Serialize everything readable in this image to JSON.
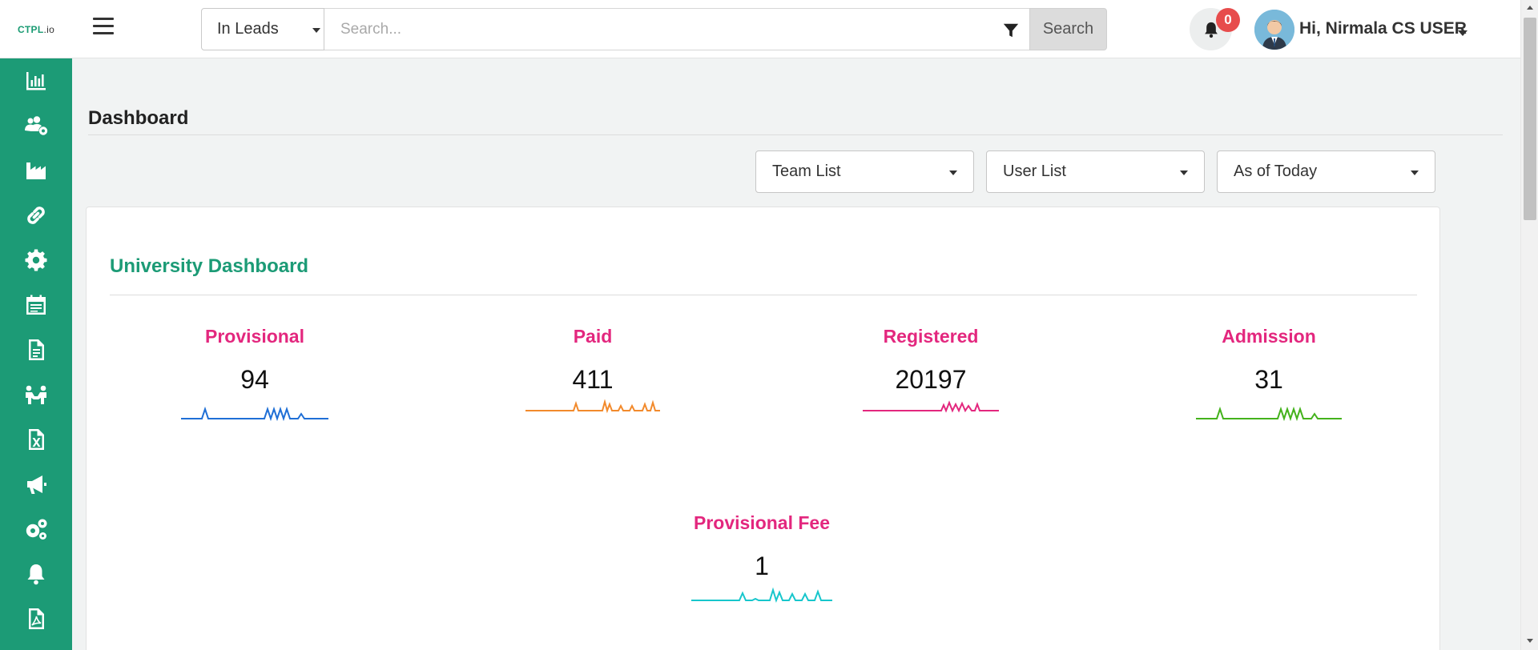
{
  "header": {
    "logo": {
      "main": "CTPL",
      "suffix": ".io"
    },
    "search": {
      "scope": "In Leads",
      "placeholder": "Search...",
      "button_label": "Search"
    },
    "notifications": {
      "count": "0"
    },
    "user": {
      "greeting": "Hi, Nirmala CS USER"
    }
  },
  "sidebar": {
    "items": [
      {
        "icon": "bar-chart-icon"
      },
      {
        "icon": "users-gear-icon"
      },
      {
        "icon": "industry-icon"
      },
      {
        "icon": "link-icon"
      },
      {
        "icon": "gear-icon"
      },
      {
        "icon": "calendar-list-icon"
      },
      {
        "icon": "document-icon"
      },
      {
        "icon": "people-meeting-icon"
      },
      {
        "icon": "excel-file-icon"
      },
      {
        "icon": "megaphone-icon"
      },
      {
        "icon": "gears-icon"
      },
      {
        "icon": "bell-icon"
      },
      {
        "icon": "pdf-file-icon"
      }
    ]
  },
  "main": {
    "page_title": "Dashboard",
    "filters": [
      {
        "label": "Team List"
      },
      {
        "label": "User List"
      },
      {
        "label": "As of Today"
      }
    ],
    "card": {
      "title": "University Dashboard",
      "stats": [
        {
          "label": "Provisional",
          "value": "94",
          "color": "#1f6fd6"
        },
        {
          "label": "Paid",
          "value": "411",
          "color": "#f28a2c"
        },
        {
          "label": "Registered",
          "value": "20197",
          "color": "#e3277e"
        },
        {
          "label": "Admission",
          "value": "31",
          "color": "#44b21c"
        },
        {
          "label": "Provisional Fee",
          "value": "1",
          "color": "#17c6cc"
        }
      ]
    }
  },
  "colors": {
    "brand": "#1c9b76",
    "stat_label": "#e3277e",
    "badge": "#e74c4c"
  }
}
